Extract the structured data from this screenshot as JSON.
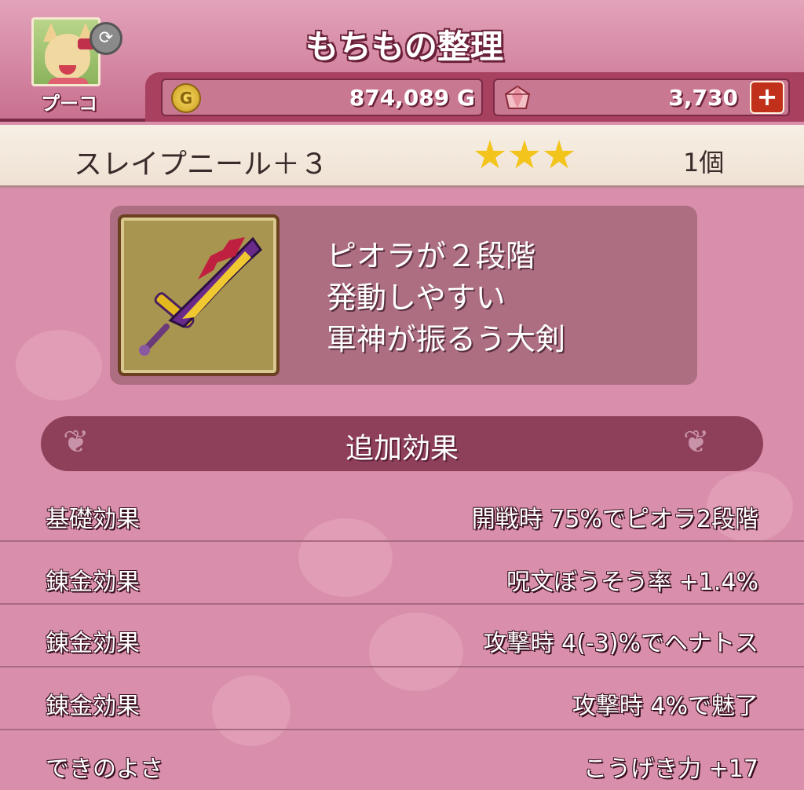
{
  "header": {
    "title": "もちもの整理",
    "character_name": "プーコ",
    "swap_icon": "swap-arrows-icon",
    "gold": "874,089 G",
    "gold_icon_letter": "G",
    "gems": "3,730",
    "add_button_symbol": "+"
  },
  "item": {
    "name": "スレイプニール＋３",
    "stars": 3,
    "count": "1個",
    "icon": "sword-icon",
    "description": [
      "ピオラが２段階",
      "発動しやすい",
      "軍神が振るう大剣"
    ]
  },
  "section": {
    "title": "追加効果"
  },
  "effects": [
    {
      "label": "基礎効果",
      "value": "開戦時  75%でピオラ2段階"
    },
    {
      "label": "錬金効果",
      "value": "呪文ぼうそう率 +1.4%"
    },
    {
      "label": "錬金効果",
      "value": "攻撃時  4(-3)%でヘナトス"
    },
    {
      "label": "錬金効果",
      "value": "攻撃時  4%で魅了"
    },
    {
      "label": "できのよさ",
      "value": "こうげき力 +17"
    }
  ],
  "colors": {
    "background": "#d98fab",
    "header": "#c8708f",
    "section_bar": "#8e3f5a",
    "star": "#f2c41c",
    "add_button": "#c0301a"
  }
}
